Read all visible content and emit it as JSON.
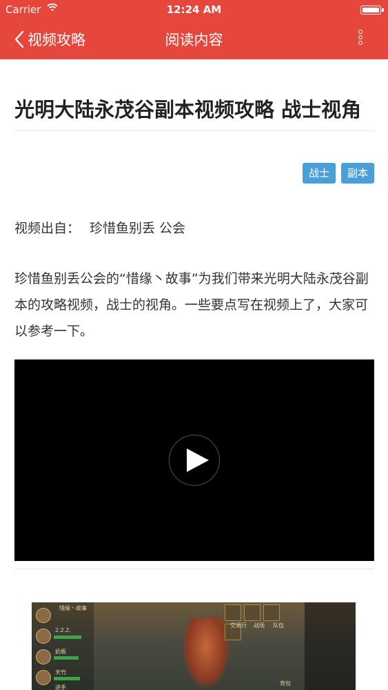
{
  "status_bar": {
    "carrier": "Carrier",
    "time": "12:24 AM"
  },
  "nav": {
    "back_label": "视频攻略",
    "title": "阅读内容"
  },
  "article": {
    "title": "光明大陆永茂谷副本视频攻略 战士视角",
    "tags": [
      "战士",
      "副本"
    ],
    "source_label": "视频出自：",
    "source_value": "珍惜鱼别丢 公会",
    "paragraph": "珍惜鱼别丢公会的“惜缘丶故事”为我们带来光明大陆永茂谷副本的攻略视频，战士的视角。一些要点写在视频上了，大家可以参考一下。"
  },
  "game_screenshot": {
    "guild_name": "惜缘丶故事",
    "party": [
      "2.2.2.",
      "奶瓶",
      "天竹",
      "进手"
    ],
    "buttons": [
      "交易行",
      "战场",
      "队伍",
      "背包"
    ]
  },
  "colors": {
    "brand_red": "#e5473c",
    "tag_blue": "#4a9fd8"
  }
}
